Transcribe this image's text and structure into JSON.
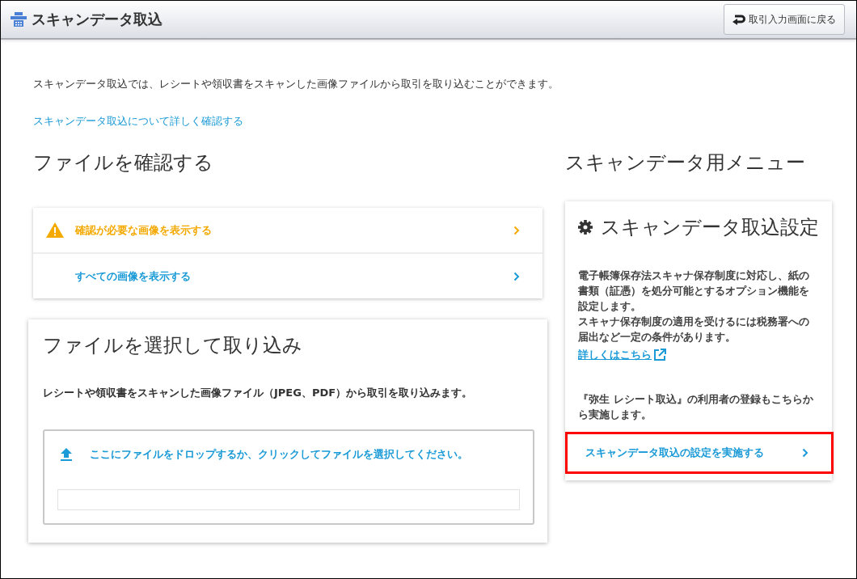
{
  "header": {
    "title": "スキャンデータ取込",
    "back_button": "取引入力画面に戻る"
  },
  "intro": {
    "text": "スキャンデータ取込では、レシートや領収書をスキャンした画像ファイルから取引を取り込むことができます。",
    "link": "スキャンデータ取込について詳しく確認する"
  },
  "check_section": {
    "heading": "ファイルを確認する",
    "items": [
      {
        "label": "確認が必要な画像を表示する",
        "kind": "warning"
      },
      {
        "label": "すべての画像を表示する",
        "kind": "plain"
      }
    ]
  },
  "import_section": {
    "heading": "ファイルを選択して取り込み",
    "description": "レシートや領収書をスキャンした画像ファイル（JPEG、PDF）から取引を取り込みます。",
    "drop_text": "ここにファイルをドロップするか、クリックしてファイルを選択してください。"
  },
  "menu": {
    "heading": "スキャンデータ用メニュー",
    "card_title": "スキャンデータ取込設定",
    "paragraphs": [
      "電子帳簿保存法スキャナ保存制度に対応し、紙の書類（証憑）を処分可能とするオプション機能を設定します。",
      "スキャナ保存制度の適用を受けるには税務署への届出など一定の条件があります。"
    ],
    "detail_link": "詳しくはこちら",
    "note": "『弥生 レシート取込』の利用者の登録もこちらから実施します。",
    "action": {
      "label": "スキャンデータ取込の設定を実施する",
      "highlighted": true
    }
  }
}
